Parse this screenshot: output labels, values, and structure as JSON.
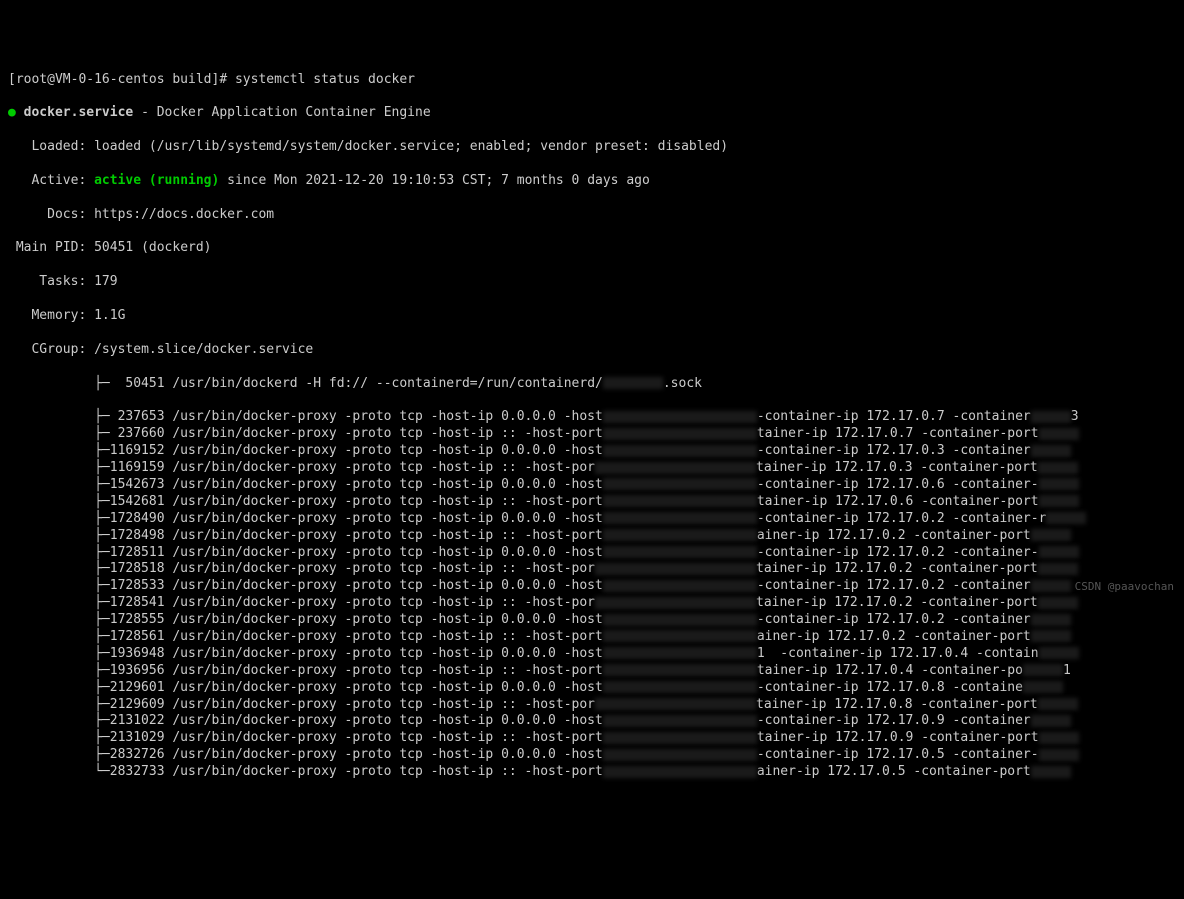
{
  "prompt": {
    "user_host": "[root@VM-0-16-centos build]#",
    "command": "systemctl status docker"
  },
  "service": {
    "bullet": "●",
    "name": "docker.service",
    "dash": "-",
    "desc": "Docker Application Container Engine"
  },
  "loaded": {
    "label": "   Loaded:",
    "value": "loaded (/usr/lib/systemd/system/docker.service; enabled; vendor preset: disabled)"
  },
  "active": {
    "label": "   Active:",
    "state": "active (running)",
    "since": "since Mon 2021-12-20 19:10:53 CST; 7 months 0 days ago"
  },
  "docs": {
    "label": "     Docs:",
    "value": "https://docs.docker.com"
  },
  "mainpid": {
    "label": " Main PID:",
    "value": "50451 (dockerd)"
  },
  "tasks": {
    "label": "    Tasks:",
    "value": "179"
  },
  "memory": {
    "label": "   Memory:",
    "value": "1.1G"
  },
  "cgroup": {
    "label": "   CGroup:",
    "value": "/system.slice/docker.service"
  },
  "tree": {
    "first_glyph": "           ├─  50451 ",
    "first_cmd": "/usr/bin/dockerd -H fd:// --containerd=/run/containerd/",
    "first_tail": ".sock",
    "rows": [
      {
        "pid": " 237653",
        "host": "0.0.0.0",
        "pre": "-host",
        "mid": "-container-ip 172.17.0.7 -container",
        "end": "3"
      },
      {
        "pid": " 237660",
        "host": "::",
        "pre": "-host-port",
        "mid": "tainer-ip 172.17.0.7 -container-port",
        "end": ""
      },
      {
        "pid": "1169152",
        "host": "0.0.0.0",
        "pre": "-host",
        "mid": "-container-ip 172.17.0.3 -container",
        "end": ""
      },
      {
        "pid": "1169159",
        "host": "::",
        "pre": "-host-por",
        "mid": "tainer-ip 172.17.0.3 -container-port",
        "end": ""
      },
      {
        "pid": "1542673",
        "host": "0.0.0.0",
        "pre": "-host",
        "mid": "-container-ip 172.17.0.6 -container-",
        "end": ""
      },
      {
        "pid": "1542681",
        "host": "::",
        "pre": "-host-port",
        "mid": "tainer-ip 172.17.0.6 -container-port",
        "end": ""
      },
      {
        "pid": "1728490",
        "host": "0.0.0.0",
        "pre": "-host",
        "mid": "-container-ip 172.17.0.2 -container-r",
        "end": ""
      },
      {
        "pid": "1728498",
        "host": "::",
        "pre": "-host-port",
        "mid": "ainer-ip 172.17.0.2 -container-port",
        "end": ""
      },
      {
        "pid": "1728511",
        "host": "0.0.0.0",
        "pre": "-host",
        "mid": "-container-ip 172.17.0.2 -container-",
        "end": ""
      },
      {
        "pid": "1728518",
        "host": "::",
        "pre": "-host-por",
        "mid": "tainer-ip 172.17.0.2 -container-port",
        "end": ""
      },
      {
        "pid": "1728533",
        "host": "0.0.0.0",
        "pre": "-host",
        "mid": "-container-ip 172.17.0.2 -container",
        "end": ""
      },
      {
        "pid": "1728541",
        "host": "::",
        "pre": "-host-por",
        "mid": "tainer-ip 172.17.0.2 -container-port",
        "end": ""
      },
      {
        "pid": "1728555",
        "host": "0.0.0.0",
        "pre": "-host",
        "mid": "-container-ip 172.17.0.2 -container",
        "end": ""
      },
      {
        "pid": "1728561",
        "host": "::",
        "pre": "-host-port",
        "mid": "ainer-ip 172.17.0.2 -container-port",
        "end": ""
      },
      {
        "pid": "1936948",
        "host": "0.0.0.0",
        "pre": "-host",
        "mid": "1  -container-ip 172.17.0.4 -contain",
        "end": ""
      },
      {
        "pid": "1936956",
        "host": "::",
        "pre": "-host-port",
        "mid": "tainer-ip 172.17.0.4 -container-po",
        "end": "1"
      },
      {
        "pid": "2129601",
        "host": "0.0.0.0",
        "pre": "-host",
        "mid": "-container-ip 172.17.0.8 -containe",
        "end": ""
      },
      {
        "pid": "2129609",
        "host": "::",
        "pre": "-host-por",
        "mid": "tainer-ip 172.17.0.8 -container-port",
        "end": ""
      },
      {
        "pid": "2131022",
        "host": "0.0.0.0",
        "pre": "-host",
        "mid": "-container-ip 172.17.0.9 -container",
        "end": ""
      },
      {
        "pid": "2131029",
        "host": "::",
        "pre": "-host-port",
        "mid": "tainer-ip 172.17.0.9 -container-port",
        "end": ""
      },
      {
        "pid": "2832726",
        "host": "0.0.0.0",
        "pre": "-host",
        "mid": "-container-ip 172.17.0.5 -container-",
        "end": ""
      },
      {
        "pid": "2832733",
        "host": "::",
        "pre": "-host-port",
        "mid": "ainer-ip 172.17.0.5 -container-port",
        "end": ""
      }
    ],
    "glyph_mid": "           ├─",
    "glyph_last": "           └─",
    "cmd": "/usr/bin/docker-proxy -proto tcp -host-ip"
  },
  "watermark": "CSDN @paavochan"
}
